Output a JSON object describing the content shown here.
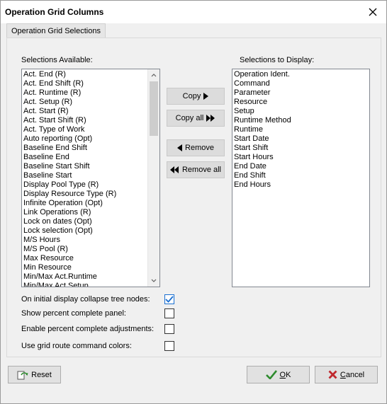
{
  "window": {
    "title": "Operation Grid Columns"
  },
  "tab": {
    "label": "Operation Grid Selections"
  },
  "available": {
    "label": "Selections Available:",
    "items": [
      "Act. End (R)",
      "Act. End Shift (R)",
      "Act. Runtime (R)",
      "Act. Setup (R)",
      "Act. Start (R)",
      "Act. Start Shift (R)",
      "Act. Type of Work",
      "Auto reporting (Opt)",
      "Baseline End Shift",
      "Baseline End",
      "Baseline Start Shift",
      "Baseline Start",
      "Display Pool Type (R)",
      "Display Resource Type (R)",
      "Infinite Operation (Opt)",
      "Link Operations (R)",
      "Lock on dates (Opt)",
      "Lock selection (Opt)",
      "M/S Hours",
      "M/S Pool (R)",
      "Max Resource",
      "Min Resource",
      "Min/Max Act.Runtime",
      "Min/Max Act.Setup"
    ]
  },
  "display": {
    "label": "Selections to Display:",
    "items": [
      "Operation Ident.",
      "Command",
      "Parameter",
      "Resource",
      "Setup",
      "Runtime Method",
      "Runtime",
      "Start Date",
      "Start Shift",
      "Start Hours",
      "End Date",
      "End Shift",
      "End Hours"
    ]
  },
  "buttons": {
    "copy": "Copy",
    "copy_all": "Copy all",
    "remove": "Remove",
    "remove_all": "Remove all",
    "reset": "Reset",
    "ok_first": "O",
    "ok_rest": "K",
    "cancel_first": "C",
    "cancel_rest": "ancel"
  },
  "options": [
    {
      "label": "On initial display collapse tree nodes:",
      "checked": true
    },
    {
      "label": "Show percent complete panel:",
      "checked": false
    },
    {
      "label": "Enable percent complete adjustments:",
      "checked": false
    },
    {
      "label": "Use grid route command colors:",
      "checked": false
    }
  ],
  "colors": {
    "check": "#1a6fd1",
    "ok_check": "#2e8b2e",
    "cancel_x": "#c0282d"
  }
}
